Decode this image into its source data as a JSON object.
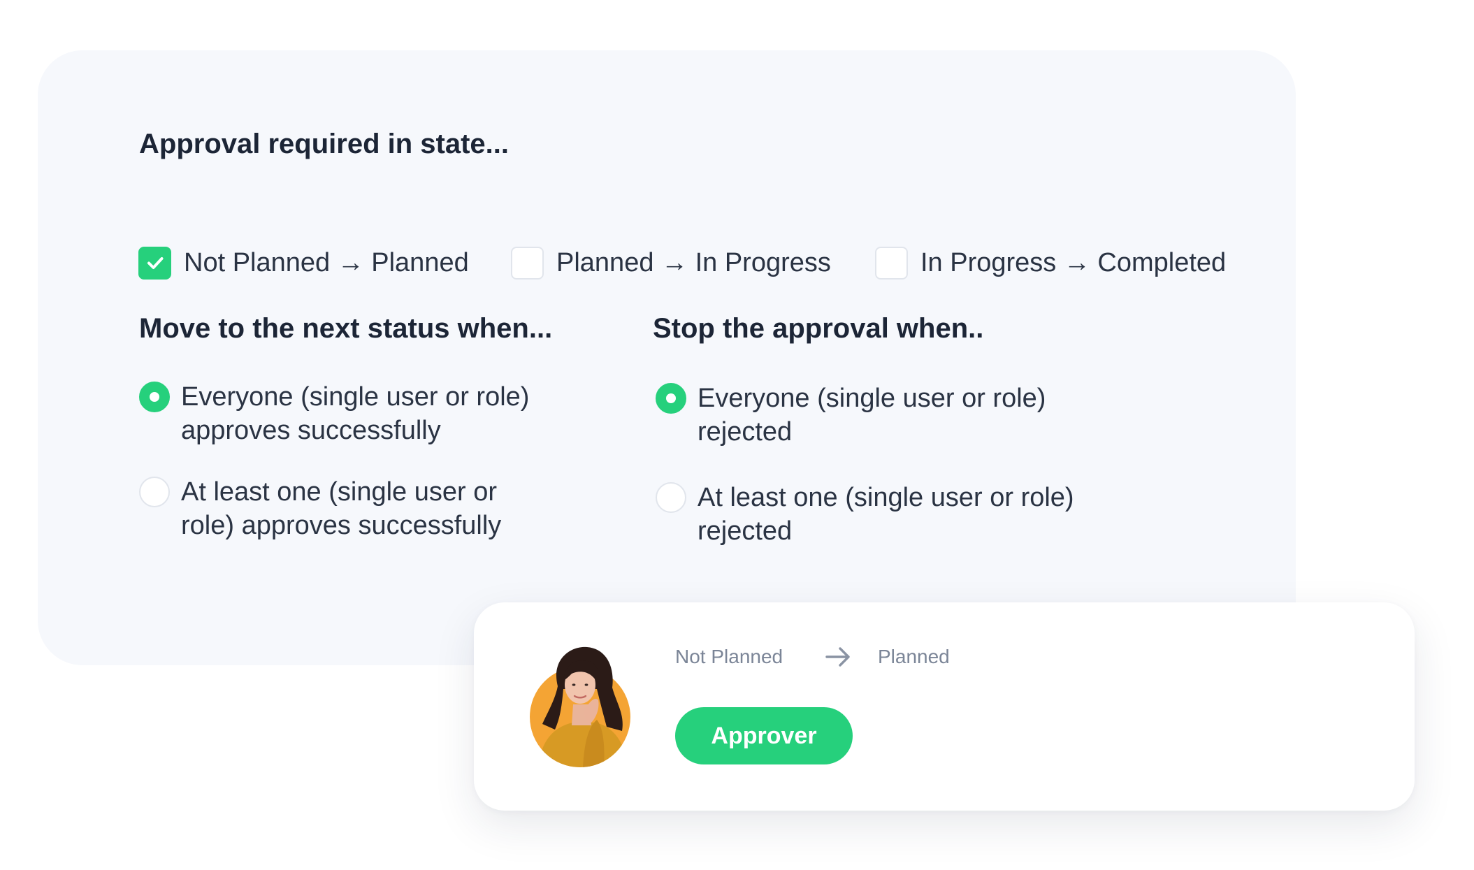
{
  "approval_required": {
    "heading": "Approval required in state...",
    "options": [
      {
        "label": "Not Planned → Planned",
        "checked": true
      },
      {
        "label": "Planned → In Progress",
        "checked": false
      },
      {
        "label": "In Progress → Completed",
        "checked": false
      }
    ]
  },
  "move_next": {
    "heading": "Move to the next status when...",
    "options": [
      {
        "line1": "Everyone (single user or role)",
        "line2": "approves successfully",
        "selected": true
      },
      {
        "line1": "At least one (single user or",
        "line2": "role) approves successfully",
        "selected": false
      }
    ]
  },
  "stop_approval": {
    "heading": "Stop the approval when..",
    "options": [
      {
        "line1": "Everyone (single user or role)",
        "line2": "rejected",
        "selected": true
      },
      {
        "line1": "At least one (single user or role)",
        "line2": "rejected",
        "selected": false
      }
    ]
  },
  "approver_card": {
    "from_state": "Not Planned",
    "to_state": "Planned",
    "arrow_icon": "arrow-right-icon",
    "button_label": "Approver",
    "avatar": "user-avatar"
  },
  "colors": {
    "accent": "#26d07c",
    "panel_bg": "#f6f8fc",
    "heading": "#1c2536",
    "body_text": "#2a3343",
    "muted_text": "#7b8597",
    "avatar_bg": "#f4a434"
  }
}
